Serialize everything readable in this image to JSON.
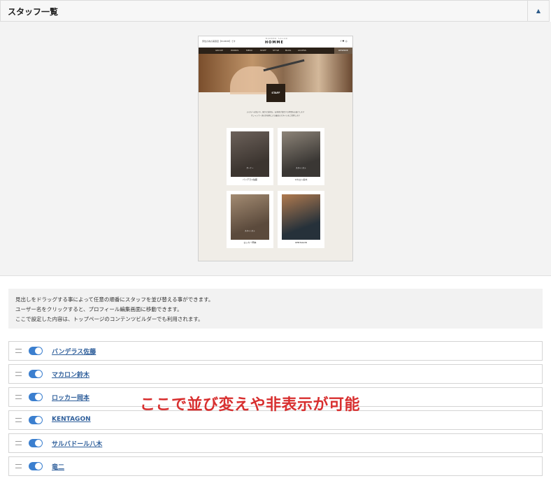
{
  "panel": {
    "title": "スタッフ一覧",
    "toggle_icon": "caret-up-icon"
  },
  "preview": {
    "site_description": "男性の為の美容室【HOMME】です",
    "logo_small": "BARBER SALON",
    "logo": "HOMME",
    "social_icons": "f ♥ ◎",
    "nav": [
      "GROUP",
      "WORKS",
      "MENU",
      "STAFF",
      "STYLE",
      "BLOG",
      "ACCESS"
    ],
    "reserve_label": "RESERVE",
    "staff_heading": "STAFF",
    "intro_lines": [
      "いのちへの想いや、確かな技術を。お客様が満足する時間をお届けします",
      "オシャレで一流の美容師による最高のスタイルをご提供します"
    ],
    "cards": [
      {
        "role": "オーナー",
        "name": "バンデラス佐藤",
        "photo_colors": [
          "#3c3530",
          "#6c615a"
        ]
      },
      {
        "role": "スタイリスト",
        "name": "マカロン鈴木",
        "photo_colors": [
          "#3a3734",
          "#8d8478"
        ]
      },
      {
        "role": "スタイリスト",
        "name": "ロッカー岡本",
        "photo_colors": [
          "#5b4a3c",
          "#a38b72"
        ]
      },
      {
        "role": "",
        "name": "KENTAGON",
        "photo_colors": [
          "#26313a",
          "#b07a4f"
        ]
      }
    ]
  },
  "info": {
    "lines": [
      "見出しをドラッグする事によって任意の順番にスタッフを並び替える事ができます。",
      "ユーザー名をクリックすると、プロフィール編集画面に移動できます。",
      "ここで設定した内容は、トップページのコンテンツビルダーでも利用されます。"
    ]
  },
  "staff_list": [
    {
      "name": "バンデラス佐藤",
      "enabled": true
    },
    {
      "name": "マカロン鈴木",
      "enabled": true
    },
    {
      "name": "ロッカー岡本",
      "enabled": true
    },
    {
      "name": "KENTAGON",
      "enabled": true
    },
    {
      "name": "サルバドール八木",
      "enabled": true
    },
    {
      "name": "竜二",
      "enabled": true
    }
  ],
  "overlay_text": "ここで並び変えや非表示が可能",
  "colors": {
    "accent": "#3b7fcf",
    "link": "#2f5f9b",
    "overlay": "#d82f2f"
  }
}
